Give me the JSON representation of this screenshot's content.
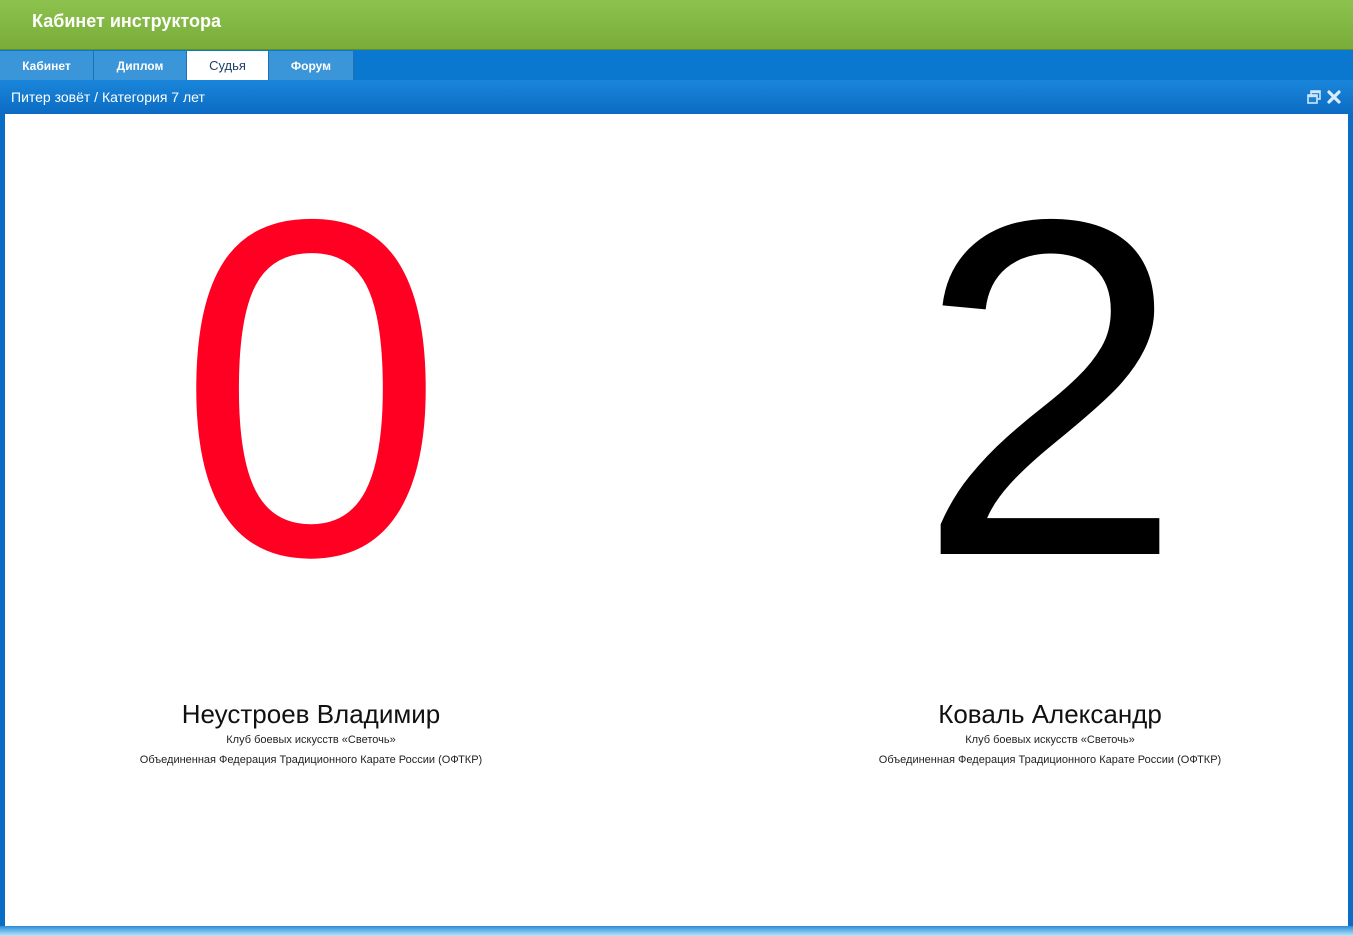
{
  "app": {
    "title": "Кабинет инструктора"
  },
  "tabs": [
    {
      "label": "Кабинет",
      "active": false
    },
    {
      "label": "Диплом",
      "active": false
    },
    {
      "label": "Судья",
      "active": true
    },
    {
      "label": "Форум",
      "active": false
    }
  ],
  "panel": {
    "title": "Питер зовёт / Категория 7 лет",
    "restore_icon": "window-restore-icon",
    "close_icon": "close-icon"
  },
  "competitors": [
    {
      "score": "0",
      "score_color": "#ff0022",
      "name": "Неустроев Владимир",
      "club": "Клуб боевых искусств «Светочь»",
      "federation": "Объединенная Федерация Традиционного Карате России (ОФТКР)"
    },
    {
      "score": "2",
      "score_color": "#000000",
      "name": "Коваль Александр",
      "club": "Клуб боевых искусств «Светочь»",
      "federation": "Объединенная Федерация Традиционного Карате России (ОФТКР)"
    }
  ],
  "colors": {
    "header_green": "#8ec24f",
    "tab_blue": "#3a95d9",
    "panel_blue": "#0b6cc2"
  }
}
